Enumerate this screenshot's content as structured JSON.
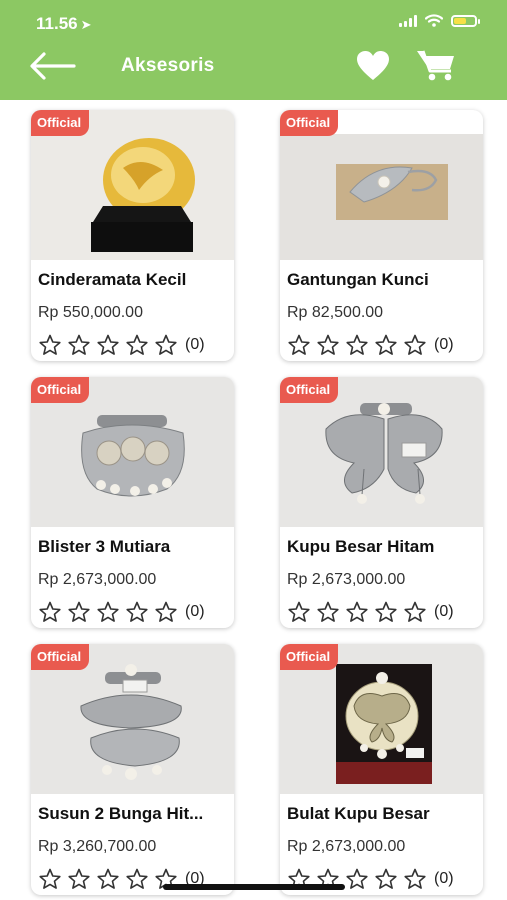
{
  "status_bar": {
    "time": "11.56"
  },
  "header": {
    "title": "Aksesoris"
  },
  "products": [
    {
      "badge": "Official",
      "name": "Cinderamata Kecil",
      "price": "Rp 550,000.00",
      "rating_count": "(0)"
    },
    {
      "badge": "Official",
      "name": "Gantungan Kunci",
      "price": "Rp 82,500.00",
      "rating_count": "(0)"
    },
    {
      "badge": "Official",
      "name": "Blister 3 Mutiara",
      "price": "Rp 2,673,000.00",
      "rating_count": "(0)"
    },
    {
      "badge": "Official",
      "name": "Kupu Besar Hitam",
      "price": "Rp 2,673,000.00",
      "rating_count": "(0)"
    },
    {
      "badge": "Official",
      "name": "Susun 2 Bunga Hit...",
      "price": "Rp 3,260,700.00",
      "rating_count": "(0)"
    },
    {
      "badge": "Official",
      "name": "Bulat Kupu Besar",
      "price": "Rp 2,673,000.00",
      "rating_count": "(0)"
    }
  ],
  "colors": {
    "header": "#8cc863",
    "badge": "#e95a4f"
  },
  "icons": [
    "back-arrow-icon",
    "heart-icon",
    "cart-icon",
    "star-outline-icon"
  ]
}
